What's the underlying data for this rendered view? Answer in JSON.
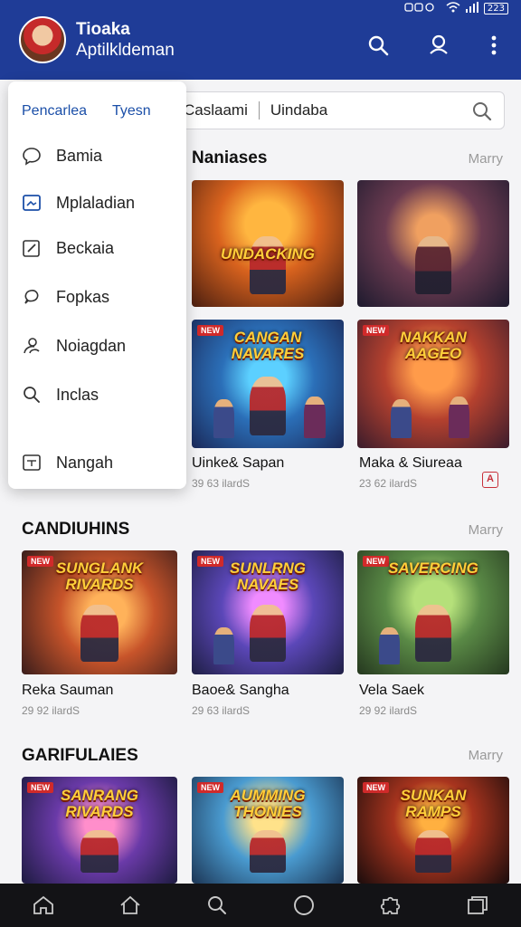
{
  "header": {
    "title": "Tioaka",
    "subtitle": "Aptilkldeman",
    "status": {
      "battery": "223"
    }
  },
  "search": {
    "segment1": "Caslaami",
    "segment2": "Uindaba"
  },
  "menu": {
    "tabs": [
      "Pencarlea",
      "Tyesn"
    ],
    "items": [
      {
        "label": "Bamia",
        "icon": "chat-bubble-icon"
      },
      {
        "label": "Mplaladian",
        "icon": "image-icon"
      },
      {
        "label": "Beckaia",
        "icon": "edit-icon"
      },
      {
        "label": "Fopkas",
        "icon": "chat-icon"
      },
      {
        "label": "Noiagdan",
        "icon": "people-icon"
      },
      {
        "label": "Inclas",
        "icon": "search-icon"
      },
      {
        "label": "Nangah",
        "icon": "document-icon"
      }
    ]
  },
  "sections": [
    {
      "title": "Naniases",
      "more": "Marry",
      "cards": [
        {
          "logo": "UNDACKING",
          "tag": ""
        },
        {
          "logo": "",
          "tag": ""
        },
        {
          "logo": "CANGAN NAVARES",
          "tag": "NEW",
          "title": "Uinke& Sapan",
          "sub": "39 63 ilardS"
        },
        {
          "logo": "NAKKAN AAGEO",
          "tag": "NEW",
          "title": "Maka & Siureaa",
          "sub": "23 62 ilardS"
        }
      ]
    },
    {
      "title": "CANDIUHINS",
      "more": "Marry",
      "cards": [
        {
          "logo": "SUNGLANK RIVARDS",
          "tag": "NEW",
          "title": "Reka Sauman",
          "sub": "29 92 ilardS"
        },
        {
          "logo": "SUNLRNG NAVAES",
          "tag": "NEW",
          "title": "Baoe& Sangha",
          "sub": "29 63 ilardS"
        },
        {
          "logo": "SAVERCING",
          "tag": "NEW",
          "title": "Vela Saek",
          "sub": "29 92 ilardS"
        }
      ]
    },
    {
      "title": "GARIFULAIES",
      "more": "Marry",
      "cards": [
        {
          "logo": "SANRANG RIVARDS",
          "tag": "NEW"
        },
        {
          "logo": "AUMMING THONIES",
          "tag": "NEW"
        },
        {
          "logo": "SUNKAN RAMPS",
          "tag": "NEW"
        }
      ]
    }
  ],
  "colors": {
    "header": "#1f3c97",
    "accent": "#1b4fa8",
    "badge": "#d02a2a"
  },
  "bottom_nav": [
    "home-outline-icon",
    "home-icon",
    "search-icon",
    "circle-icon",
    "puzzle-icon",
    "recents-icon"
  ]
}
